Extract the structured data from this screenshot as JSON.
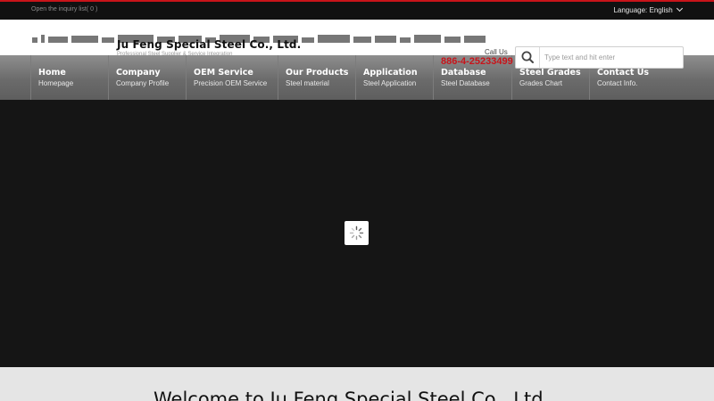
{
  "topbar": {
    "inquiry_label": "Open the inquiry list( 0 )",
    "language_label": "Language:",
    "language_value": "English"
  },
  "header": {
    "title": "Ju Feng Special Steel Co., Ltd.",
    "slogan": "Professional Steel Supplier & Service Integration",
    "call_label": "Call Us",
    "phone": "886-4-25233499"
  },
  "search": {
    "placeholder": "Type text and hit enter"
  },
  "nav": [
    {
      "title": "Home",
      "sub": "Homepage"
    },
    {
      "title": "Company",
      "sub": "Company Profile"
    },
    {
      "title": "OEM Service",
      "sub": "Precision OEM Service"
    },
    {
      "title": "Our Products",
      "sub": "Steel material"
    },
    {
      "title": "Application",
      "sub": "Steel Application"
    },
    {
      "title": "Database",
      "sub": "Steel Database"
    },
    {
      "title": "Steel Grades",
      "sub": "Grades Chart"
    },
    {
      "title": "Contact Us",
      "sub": "Contact Info."
    }
  ],
  "welcome": {
    "heading": "Welcome to Ju Feng Special Steel Co., Ltd."
  },
  "colors": {
    "accent": "#c8141a",
    "topbar": "#111111",
    "hero": "#151515",
    "nav": "#6b6b6b"
  },
  "icons": {
    "search": "search-icon",
    "language": "chevron-down-icon",
    "loader": "loading-spinner-icon"
  }
}
